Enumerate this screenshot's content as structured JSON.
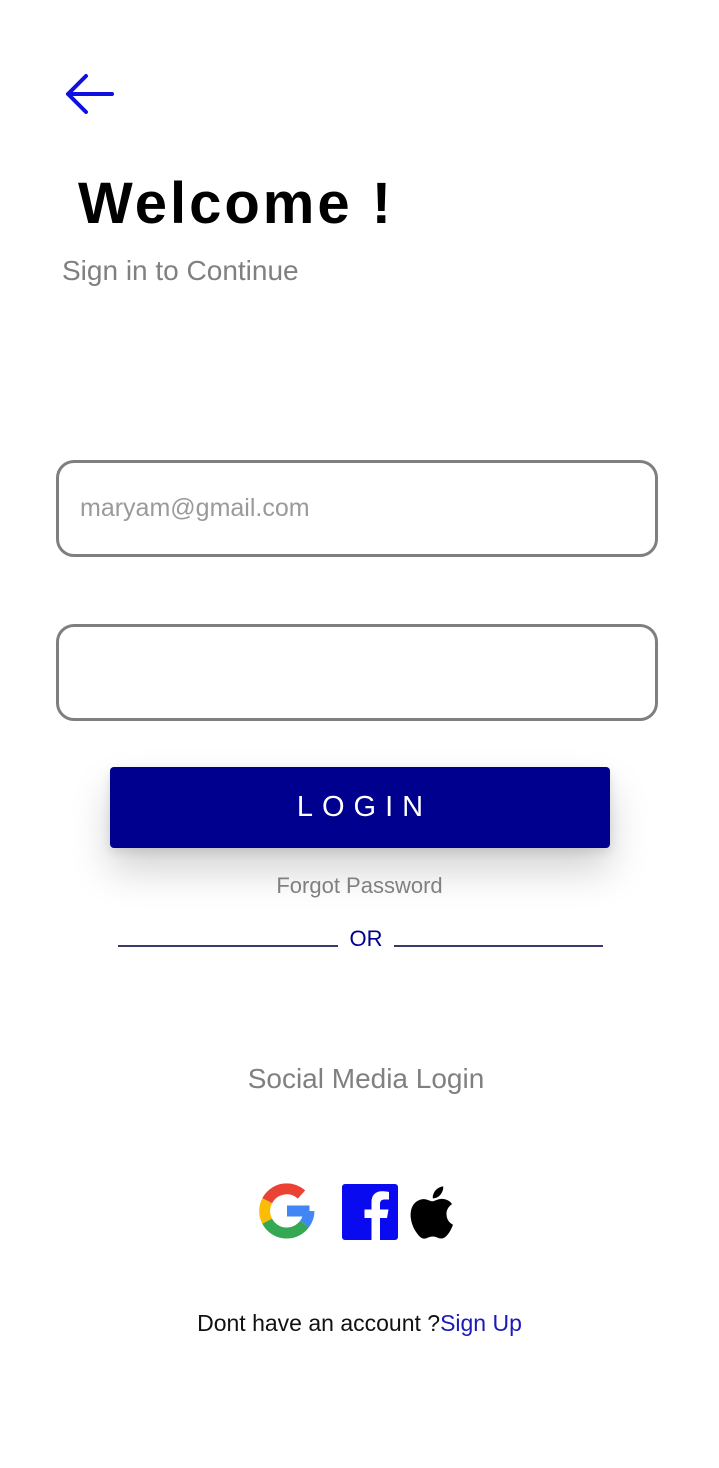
{
  "header": {
    "title": "Welcome !",
    "subtitle": "Sign in to Continue"
  },
  "form": {
    "email_placeholder": "maryam@gmail.com",
    "email_value": "",
    "password_value": "",
    "login_label": "LOGIN",
    "forgot_label": "Forgot Password",
    "divider_label": "OR"
  },
  "social": {
    "title": "Social Media Login",
    "icons": [
      "google-icon",
      "facebook-icon",
      "apple-icon"
    ]
  },
  "footer": {
    "prompt": "Dont have an account ?",
    "signup_label": "Sign Up"
  },
  "colors": {
    "primary": "#00008f",
    "back_arrow": "#1010e0",
    "muted_text": "#808080",
    "link": "#1a1ab8"
  }
}
